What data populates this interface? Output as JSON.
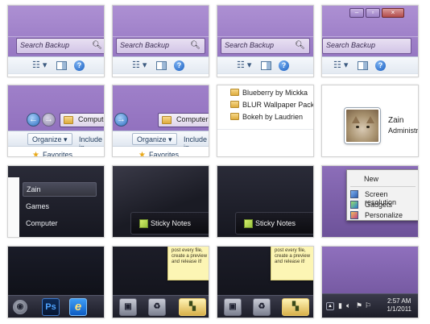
{
  "explorer": {
    "search_placeholder": "Search Backup",
    "window_buttons": [
      "–",
      "▫",
      "×"
    ],
    "help_glyph": "?",
    "views_glyph": "☷ ▾"
  },
  "navigation": {
    "address": "Computer",
    "organize": "Organize ▾",
    "include": "Include in",
    "favorites": "Favorites"
  },
  "wallpapers": {
    "items": [
      "Blueberry by Mickka",
      "BLUR Wallpaper Pack by Smaq",
      "Bokeh by Laudrien"
    ]
  },
  "user": {
    "name": "Zain",
    "role": "Administrator"
  },
  "start_menu": {
    "items": [
      "Zain",
      "Games",
      "Computer"
    ]
  },
  "sticky_notes": {
    "label": "Sticky Notes",
    "note_text": "post every file, create a preview and release it!"
  },
  "context_menu": {
    "items": [
      "New",
      "Screen resolution",
      "Gadgets",
      "Personalize"
    ]
  },
  "taskbar": {
    "ps_label": "Ps",
    "ie_label": "e",
    "clock_time": "2:57 AM",
    "clock_date": "1/1/2011"
  }
}
